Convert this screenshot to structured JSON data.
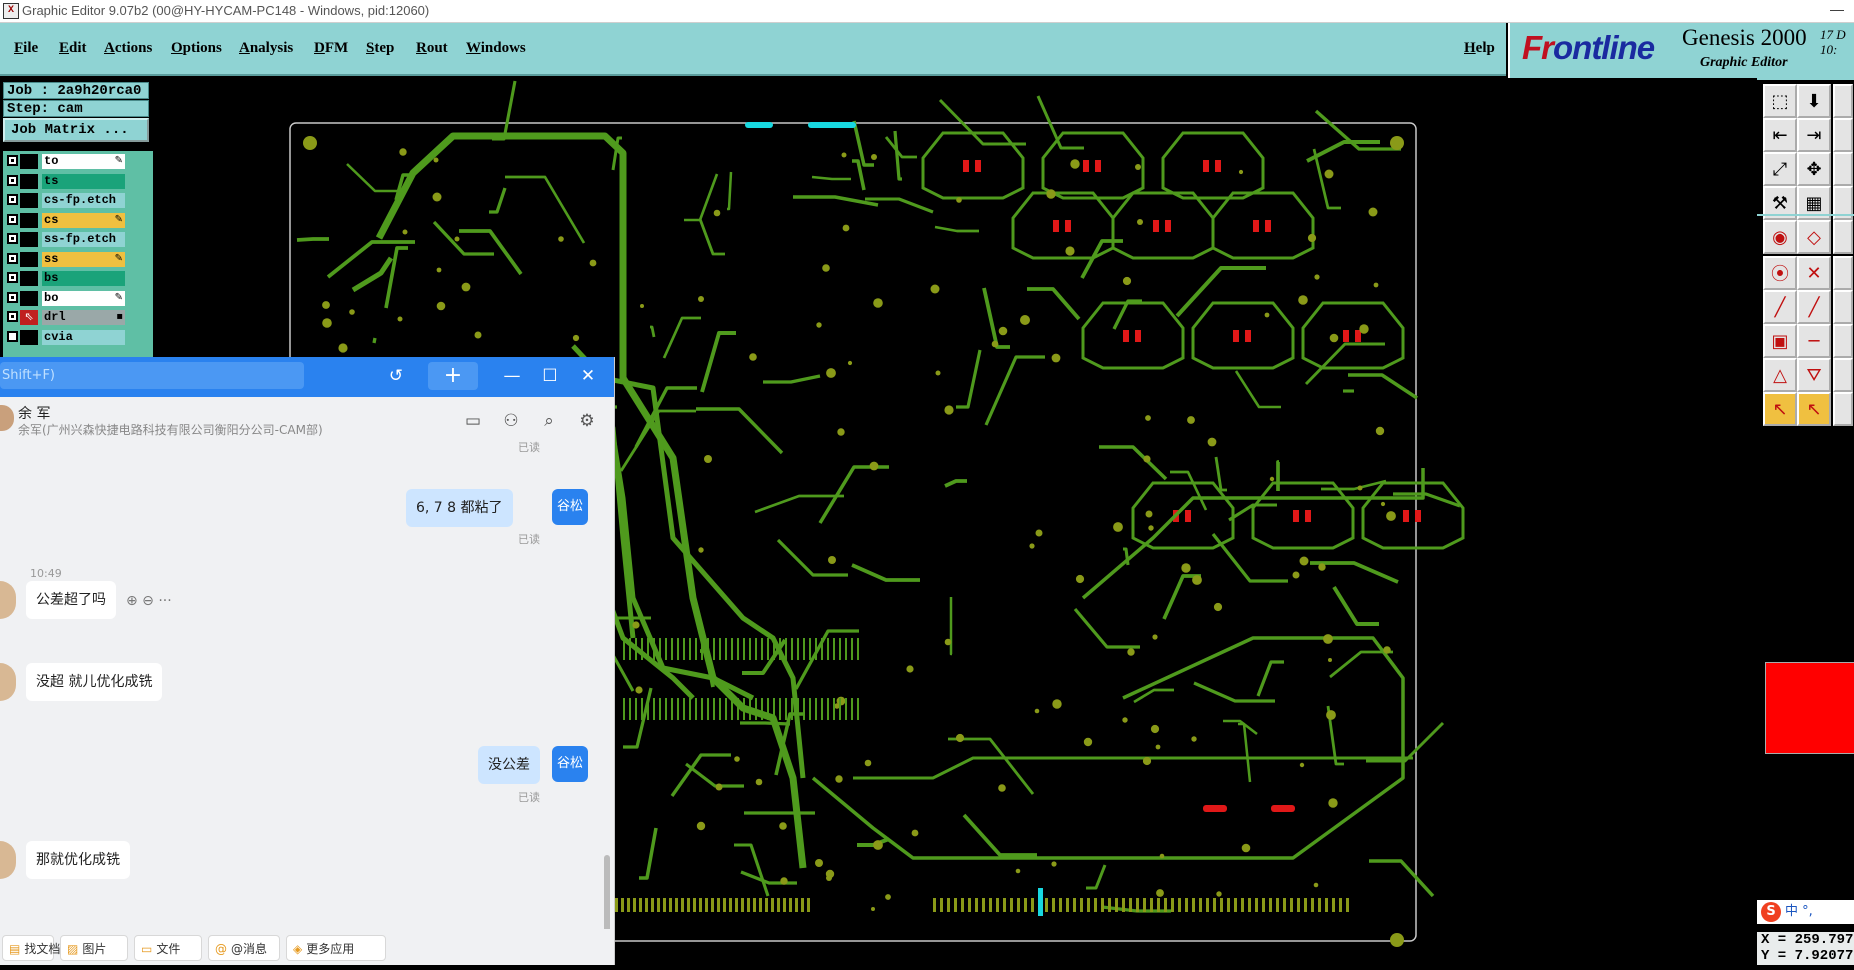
{
  "window": {
    "title": "Graphic Editor 9.07b2 (00@HY-HYCAM-PC148 - Windows, pid:12060)",
    "app_icon": "X",
    "min_label": "—"
  },
  "menu": {
    "items": [
      "File",
      "Edit",
      "Actions",
      "Options",
      "Analysis",
      "DFM",
      "Step",
      "Rout",
      "Windows"
    ],
    "help": "Help"
  },
  "logo": {
    "frontline_a": "Fr",
    "frontline_b": "ontline",
    "product": "Genesis 2000",
    "subtitle": "Graphic Editor",
    "date_line1": "17 D",
    "date_line2": "10:"
  },
  "job": {
    "job_label": "Job : 2a9h20rca0",
    "step_label": "Step: cam",
    "matrix_button": "Job Matrix ..."
  },
  "layers": [
    {
      "name": "to",
      "bg": "#ffffff",
      "checked": true,
      "edit": "✎"
    },
    {
      "name": "ts",
      "bg": "#1aa37a",
      "checked": true,
      "edit": ""
    },
    {
      "name": "cs-fp.etch",
      "bg": "#8fd3d3",
      "checked": true,
      "edit": ""
    },
    {
      "name": "cs",
      "bg": "#f0c040",
      "checked": true,
      "edit": "✎"
    },
    {
      "name": "ss-fp.etch",
      "bg": "#8fd3d3",
      "checked": true,
      "edit": ""
    },
    {
      "name": "ss",
      "bg": "#f0c040",
      "checked": true,
      "edit": "✎"
    },
    {
      "name": "bs",
      "bg": "#1aa37a",
      "checked": true,
      "edit": ""
    },
    {
      "name": "bo",
      "bg": "#ffffff",
      "checked": true,
      "edit": "✎"
    },
    {
      "name": "drl",
      "bg": "#9aa8a8",
      "checked": true,
      "edit": "▪"
    },
    {
      "name": "cvia",
      "bg": "#8fd3d3",
      "checked": false,
      "edit": ""
    }
  ],
  "colors": {
    "trace": "#4f9a1d",
    "pad": "#8a9a18",
    "feature_red": "#e01818",
    "feature_cyan": "#18d8e0",
    "board_outline": "#c8c8c8",
    "menu_bg": "#8fd3d3"
  },
  "coords": {
    "x": "X = 259.797",
    "y": "Y = 7.92077"
  },
  "ime": {
    "logo": "S",
    "text": "中 °,"
  },
  "chat": {
    "search_placeholder": "Shift+F)",
    "plus": "+",
    "history_icon": "history-icon",
    "contact_name": "余 军",
    "contact_sub": "余军(广州兴森快捷电路科技有限公司衡阳分公司-CAM部)",
    "my_avatar_label": "谷松",
    "messages": [
      {
        "from": "me",
        "text": "6,   7    8 都粘了",
        "read": "已读"
      },
      {
        "from": "them",
        "time": "10:49",
        "text": "公差超了吗"
      },
      {
        "from": "them",
        "text": "没超 就儿优化成铣"
      },
      {
        "from": "me",
        "text": "没公差",
        "read": "已读"
      },
      {
        "from": "them",
        "text": "那就优化成铣"
      }
    ],
    "top_read": "已读",
    "msg_tools": "⊕ ⊖ ···",
    "bottom_tools": [
      {
        "icon": "document-icon",
        "glyph": "▤",
        "label": "找文档"
      },
      {
        "icon": "image-icon",
        "glyph": "▨",
        "label": "图片"
      },
      {
        "icon": "folder-icon",
        "glyph": "▭",
        "label": "文件"
      },
      {
        "icon": "at-icon",
        "glyph": "@",
        "label": "@消息"
      },
      {
        "icon": "apps-icon",
        "glyph": "◈",
        "label": "更多应用"
      }
    ]
  }
}
